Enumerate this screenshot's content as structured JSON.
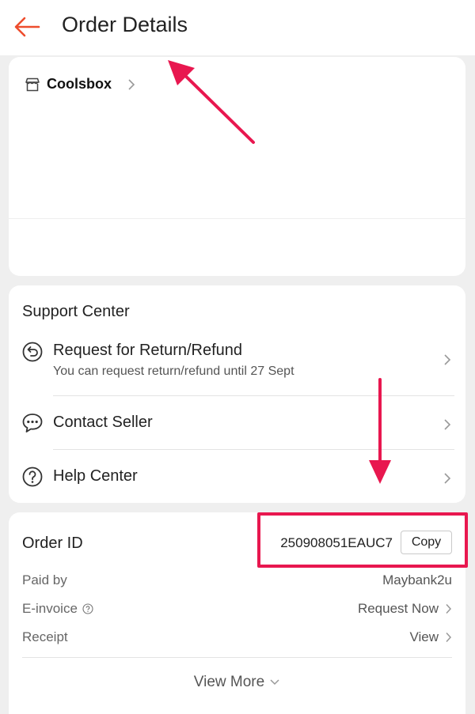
{
  "header": {
    "title": "Order Details"
  },
  "shop": {
    "name": "Coolsbox"
  },
  "support": {
    "title": "Support Center",
    "items": [
      {
        "label": "Request for Return/Refund",
        "sub": "You can request return/refund until 27 Sept",
        "icon": "return-icon"
      },
      {
        "label": "Contact Seller",
        "icon": "chat-icon"
      },
      {
        "label": "Help Center",
        "icon": "help-icon"
      }
    ]
  },
  "order": {
    "label": "Order ID",
    "id": "250908051EAUC7",
    "copy_label": "Copy",
    "rows": [
      {
        "key": "Paid by",
        "value": "Maybank2u"
      },
      {
        "key": "E-invoice",
        "value": "Request Now"
      },
      {
        "key": "Receipt",
        "value": "View"
      }
    ],
    "view_more": "View More"
  },
  "colors": {
    "accent": "#ee4d2d",
    "annotation": "#e8174f"
  }
}
